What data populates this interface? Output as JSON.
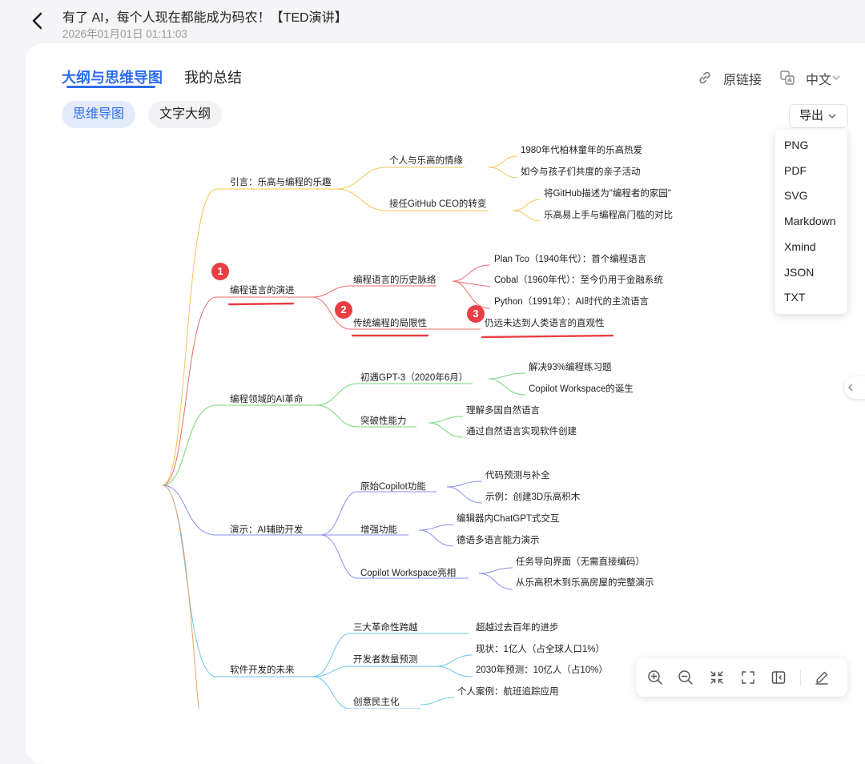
{
  "header": {
    "title": "有了 AI，每个人现在都能成为码农！【TED演讲】",
    "timestamp": "2026年01月01日 01:11:03"
  },
  "tabs": {
    "outline_mindmap": "大纲与思维导图",
    "my_summary": "我的总结"
  },
  "top_actions": {
    "original_link": "原链接",
    "language": "中文"
  },
  "view_toggle": {
    "mindmap": "思维导图",
    "text_outline": "文字大纲"
  },
  "export": {
    "label": "导出",
    "options": [
      "PNG",
      "PDF",
      "SVG",
      "Markdown",
      "Xmind",
      "JSON",
      "TXT"
    ]
  },
  "badges": [
    "1",
    "2",
    "3"
  ],
  "mindmap": {
    "b1": "引言：乐高与编程的乐趣",
    "b1_1": "个人与乐高的情缘",
    "b1_1_1": "1980年代柏林童年的乐高热爱",
    "b1_1_2": "如今与孩子们共度的亲子活动",
    "b1_2": "接任GitHub CEO的转变",
    "b1_2_1": "将GitHub描述为\"编程者的家园\"",
    "b1_2_2": "乐高易上手与编程高门槛的对比",
    "b2": "编程语言的演进",
    "b2_1": "编程语言的历史脉络",
    "b2_1_1": "Plan Tco（1940年代）：首个编程语言",
    "b2_1_2": "Cobal（1960年代）：至今仍用于金融系统",
    "b2_1_3": "Python（1991年）：AI时代的主流语言",
    "b2_2": "传统编程的局限性",
    "b2_2_1": "仍远未达到人类语言的直观性",
    "b3": "编程领域的AI革命",
    "b3_1": "初遇GPT-3（2020年6月）",
    "b3_1_1": "解决93%编程练习题",
    "b3_1_2": "Copilot Workspace的诞生",
    "b3_2": "突破性能力",
    "b3_2_1": "理解多国自然语言",
    "b3_2_2": "通过自然语言实现软件创建",
    "b4": "演示：AI辅助开发",
    "b4_1": "原始Copilot功能",
    "b4_1_1": "代码预测与补全",
    "b4_1_2": "示例：创建3D乐高积木",
    "b4_2": "增强功能",
    "b4_2_1": "编辑器内ChatGPT式交互",
    "b4_2_2": "德语多语言能力演示",
    "b4_3": "Copilot Workspace亮相",
    "b4_3_1": "任务导向界面（无需直接编码）",
    "b4_3_2": "从乐高积木到乐高房屋的完整演示",
    "b5": "软件开发的未来",
    "b5_1": "三大革命性跨越",
    "b5_1_1": "超越过去百年的进步",
    "b5_2": "开发者数量预测",
    "b5_2_1": "现状：1亿人（占全球人口1%）",
    "b5_2_2": "2030年预测：10亿人（占10%）",
    "b5_3": "创意民主化",
    "b5_3_1": "个人案例：航班追踪应用"
  },
  "colors": {
    "accent": "#2f6df0",
    "badge": "#e83e44",
    "branch1": "#f5c451",
    "branch2": "#ef6b6b",
    "branch3": "#74d67a",
    "branch4": "#8b8ef0",
    "branch5": "#6fc6ea"
  }
}
